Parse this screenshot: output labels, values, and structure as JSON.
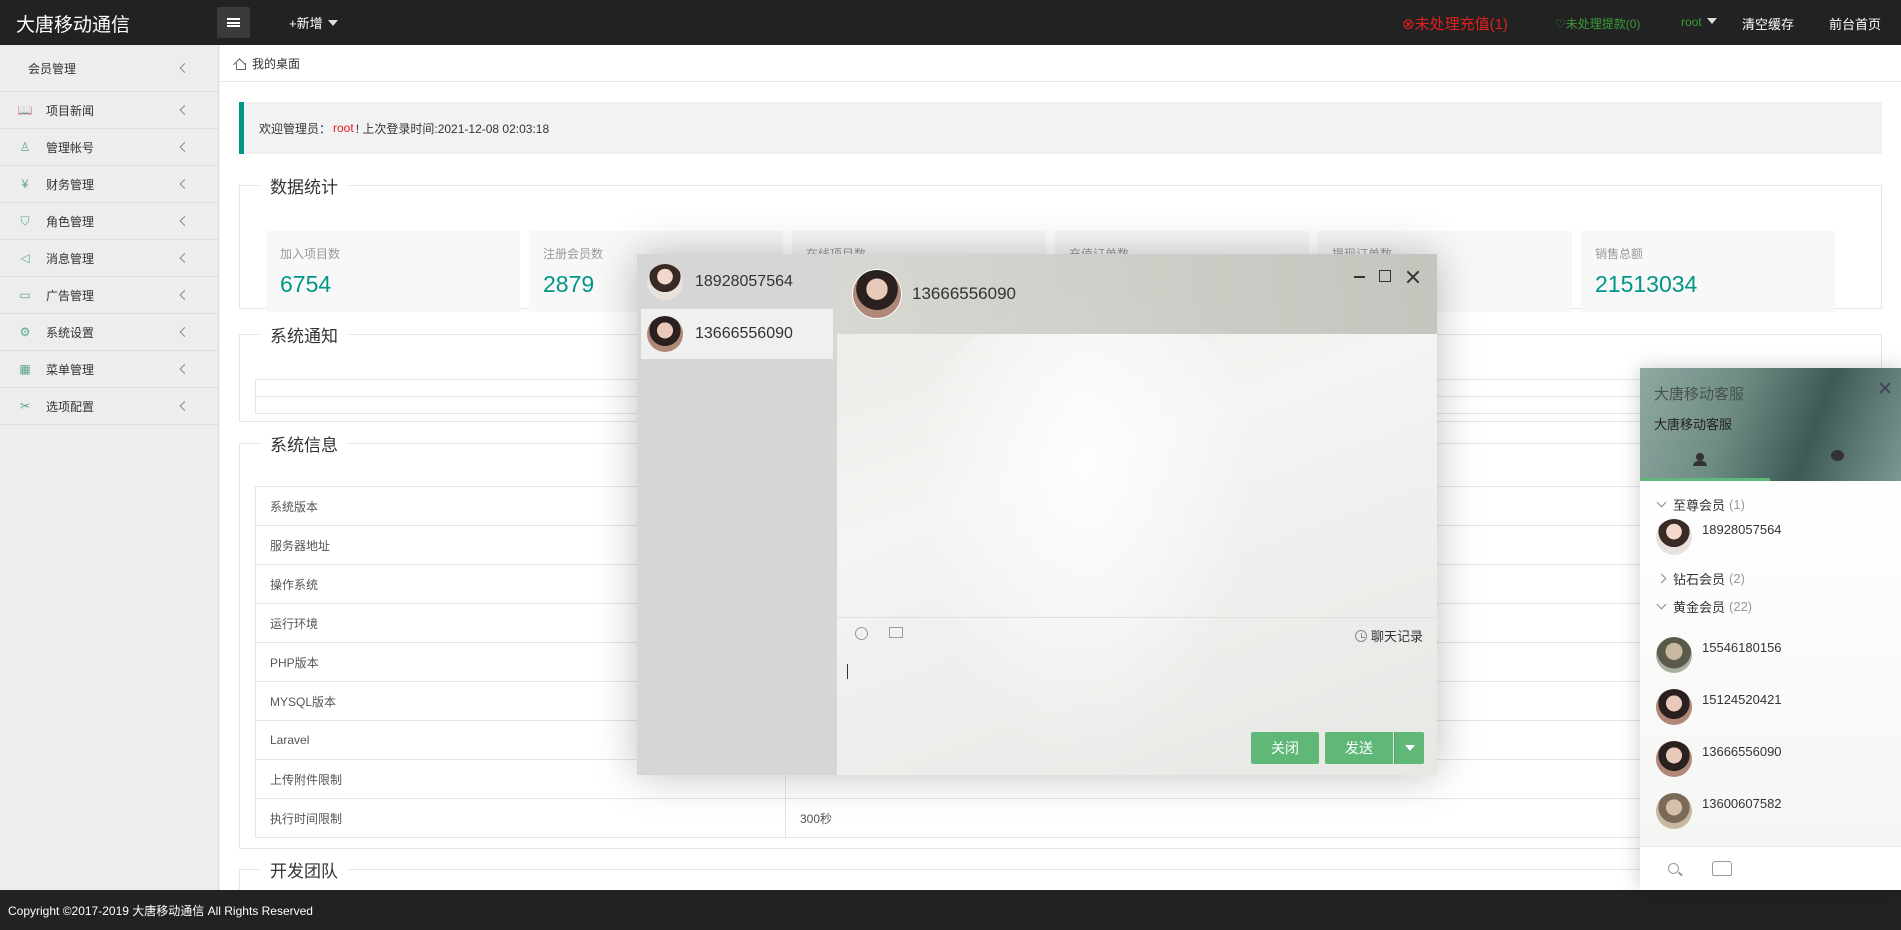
{
  "header": {
    "brand": "大唐移动通信",
    "add_new": "+新增",
    "recharge_alert": "⊗未处理充值(1)",
    "withdraw_alert": "♡未处理提款(0)",
    "user": "root",
    "clear_cache": "清空缓存",
    "front_home": "前台首页"
  },
  "sidebar": {
    "head": "会员管理",
    "items": [
      {
        "label": "项目新闻",
        "icon": "book-icon"
      },
      {
        "label": "管理帐号",
        "icon": "user-icon"
      },
      {
        "label": "财务管理",
        "icon": "money-icon"
      },
      {
        "label": "角色管理",
        "icon": "shield-icon"
      },
      {
        "label": "消息管理",
        "icon": "speaker-icon"
      },
      {
        "label": "广告管理",
        "icon": "image-icon"
      },
      {
        "label": "系统设置",
        "icon": "gear-icon"
      },
      {
        "label": "菜单管理",
        "icon": "grid-icon"
      },
      {
        "label": "选项配置",
        "icon": "wrench-icon"
      }
    ]
  },
  "breadcrumb": "我的桌面",
  "welcome": {
    "prefix": "欢迎管理员：",
    "user": "root",
    "suffix": "! 上次登录时间:2021-12-08 02:03:18"
  },
  "stats": {
    "title": "数据统计",
    "cards": [
      {
        "label": "加入项目数",
        "value": "6754"
      },
      {
        "label": "注册会员数",
        "value": "2879"
      },
      {
        "label": "在线项目数",
        "value": ""
      },
      {
        "label": "充值订单数",
        "value": ""
      },
      {
        "label": "提现订单数",
        "value": ""
      },
      {
        "label": "销售总额",
        "value": "21513034"
      }
    ]
  },
  "notice": {
    "title": "系统通知"
  },
  "sysinfo": {
    "title": "系统信息",
    "rows": [
      {
        "key": "系统版本",
        "value": ""
      },
      {
        "key": "服务器地址",
        "value": ""
      },
      {
        "key": "操作系统",
        "value": ""
      },
      {
        "key": "运行环境",
        "value": ""
      },
      {
        "key": "PHP版本",
        "value": ""
      },
      {
        "key": "MYSQL版本",
        "value": ""
      },
      {
        "key": "Laravel",
        "value": ""
      },
      {
        "key": "上传附件限制",
        "value": ""
      },
      {
        "key": "执行时间限制",
        "value": "300秒"
      }
    ]
  },
  "team": {
    "title": "开发团队"
  },
  "footer": "Copyright ©2017-2019 大唐移动通信 All Rights Reserved",
  "chat": {
    "contacts": [
      "18928057564",
      "13666556090"
    ],
    "active_name": "13666556090",
    "history": "聊天记录",
    "close_btn": "关闭",
    "send_btn": "发送"
  },
  "cs_panel": {
    "title": "大唐移动客服",
    "subtitle": "大唐移动客服",
    "groups": [
      {
        "name": "至尊会员",
        "count": "(1)",
        "members": [
          "18928057564"
        ]
      },
      {
        "name": "钻石会员",
        "count": "(2)",
        "members": []
      },
      {
        "name": "黄金会员",
        "count": "(22)",
        "members": [
          "15546180156",
          "15124520421",
          "13666556090",
          "13600607582"
        ]
      }
    ]
  }
}
